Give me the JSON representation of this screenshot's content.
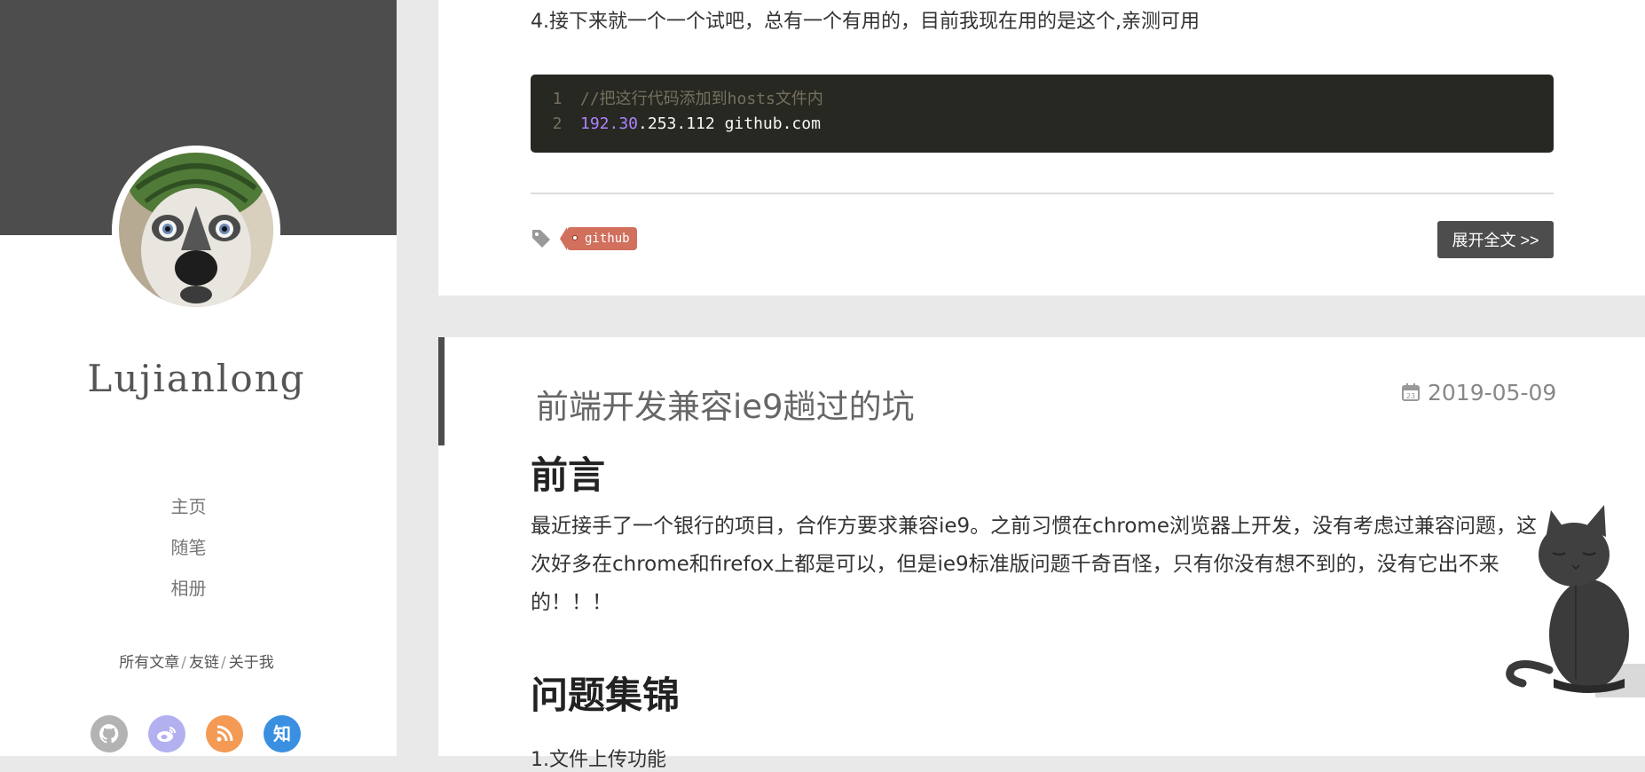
{
  "sidebar": {
    "site_name": "Lujianlong",
    "nav": [
      {
        "label": "主页"
      },
      {
        "label": "随笔"
      },
      {
        "label": "相册"
      }
    ],
    "links": [
      {
        "label": "所有文章"
      },
      {
        "label": "友链"
      },
      {
        "label": "关于我"
      }
    ],
    "link_separator": "/",
    "socials": [
      {
        "name": "github",
        "icon": "github-icon",
        "color": "#b3b3b3"
      },
      {
        "name": "weibo",
        "icon": "weibo-icon",
        "color": "#b3b0f0"
      },
      {
        "name": "rss",
        "icon": "rss-icon",
        "color": "#f49a55"
      },
      {
        "name": "zhihu",
        "icon": "zhihu-icon",
        "glyph": "知",
        "color": "#3a8fe0"
      }
    ]
  },
  "previous_post": {
    "step_text": "4.接下来就一个一个试吧，总有一个有用的，目前我现在用的是这个,亲测可用",
    "code": {
      "lines": [
        {
          "number": "1",
          "comment": "//把这行代码添加到hosts文件内"
        },
        {
          "number": "2",
          "num": "192.30",
          "rest": ".253.112 github.com"
        }
      ]
    },
    "tags": [
      "github"
    ],
    "read_more": "展开全文 >>"
  },
  "post": {
    "title": "前端开发兼容ie9趟过的坑",
    "date": "2019-05-09",
    "section1": "前言",
    "body": "最近接手了一个银行的项目，合作方要求兼容ie9。之前习惯在chrome浏览器上开发，没有考虑过兼容问题，这次好多在chrome和firefox上都是可以，但是ie9标准版问题千奇百怪，只有你没有想不到的，没有它出不来的！！！",
    "section2": "问题集锦",
    "cut_off_text": "1.文件上传功能"
  },
  "colors": {
    "sidebar_cover": "#4d4d4d",
    "code_bg": "#272822",
    "tag": "#d0705d",
    "button": "#4d4d4d"
  }
}
